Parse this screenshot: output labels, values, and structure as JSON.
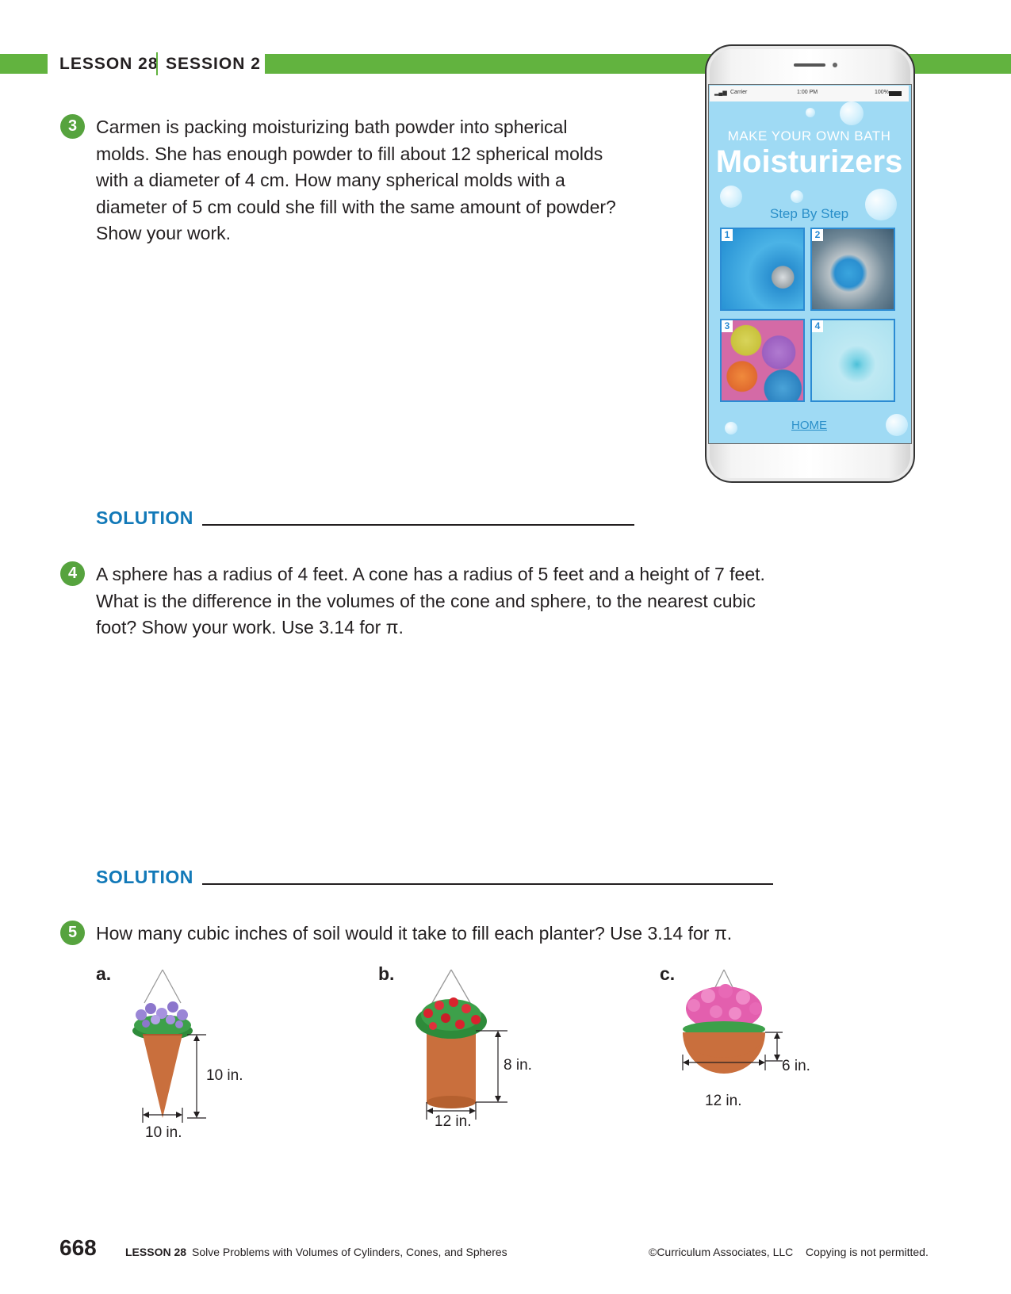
{
  "header": {
    "lesson": "LESSON 28",
    "session": "SESSION 2"
  },
  "problems": [
    {
      "number": "3",
      "lines": [
        "Carmen is packing moisturizing bath powder into spherical",
        "molds. She has enough powder to fill about 12 spherical molds",
        "with a diameter of 4 cm. How many spherical molds with a",
        "diameter of 5 cm could she fill with the same amount of powder?",
        "Show your work."
      ],
      "solution_label": "SOLUTION"
    },
    {
      "number": "4",
      "lines": [
        "A sphere has a radius of 4 feet. A cone has a radius of 5 feet and a height of 7 feet.",
        "What is the difference in the volumes of the cone and sphere, to the nearest cubic",
        "foot? Show your work. Use 3.14 for π."
      ],
      "solution_label": "SOLUTION"
    },
    {
      "number": "5",
      "lines": [
        "How many cubic inches of soil would it take to fill each planter? Use 3.14 for π."
      ]
    }
  ],
  "planters": [
    {
      "label": "a.",
      "height": "10 in.",
      "width": "10 in."
    },
    {
      "label": "b.",
      "height": "8 in.",
      "width": "12 in."
    },
    {
      "label": "c.",
      "height": "6 in.",
      "width": "12 in."
    }
  ],
  "phone": {
    "status": {
      "carrier": "Carrier",
      "time": "1:00 PM",
      "battery": "100%"
    },
    "subtitle": "MAKE YOUR OWN BATH",
    "title": "Moisturizers",
    "step": "Step By Step",
    "tiles": [
      "1",
      "2",
      "3",
      "4"
    ],
    "home": "HOME",
    "colors": {
      "screen": "#9fdaf4",
      "accent": "#2a8fc9"
    }
  },
  "footer": {
    "page": "668",
    "lesson": "LESSON 28",
    "title": "Solve Problems with Volumes of Cylinders, Cones, and Spheres",
    "copyright": "©Curriculum Associates, LLC",
    "notice": "Copying is not permitted."
  },
  "colors": {
    "band": "#62b33f",
    "number_badge": "#56a33e",
    "solution": "#1279b8"
  }
}
